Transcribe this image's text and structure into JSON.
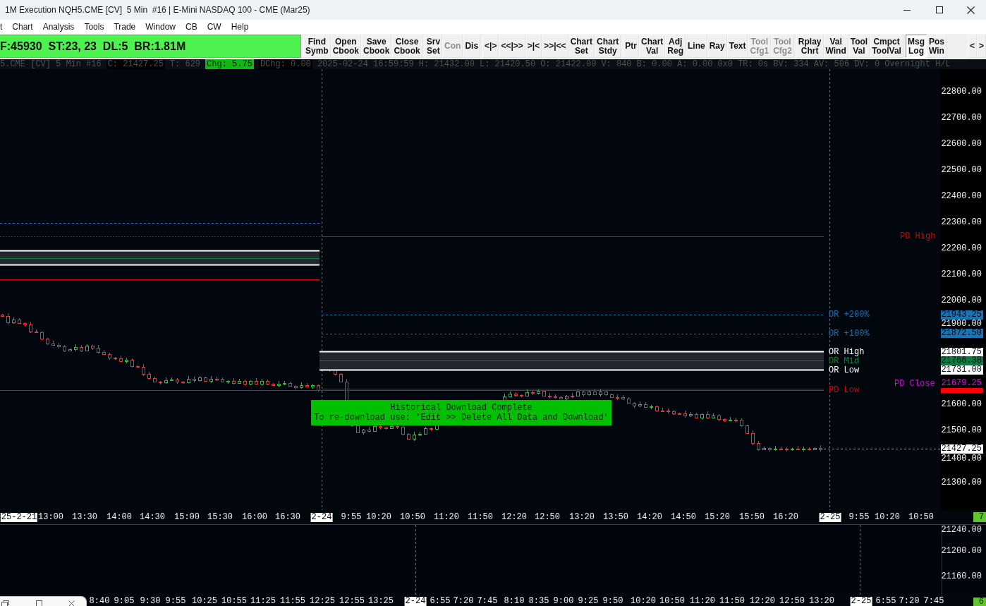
{
  "window": {
    "title": "1M Execution NQH5.CME [CV]  5 Min  #16 | E-Mini NASDAQ 100 - CME (Mar25)"
  },
  "menu": [
    "t",
    "Chart",
    "Analysis",
    "Tools",
    "Trade",
    "Window",
    "CB",
    "CW",
    "Help"
  ],
  "toolbar": {
    "status": "F:45930  ST:23, 23  DL:5  BR:1.81M",
    "groups": [
      [
        {
          "label": "Find\nSymb",
          "disabled": false,
          "on": false
        },
        {
          "label": "Open\nCbook",
          "disabled": false,
          "on": false
        },
        {
          "label": "Save\nCbook",
          "disabled": false,
          "on": false
        },
        {
          "label": "Close\nCbook",
          "disabled": false,
          "on": false
        }
      ],
      [
        {
          "label": "Srv\nSet",
          "disabled": false,
          "on": false
        },
        {
          "label": "Con",
          "disabled": true,
          "on": false
        },
        {
          "label": "Dis",
          "disabled": false,
          "on": false
        }
      ],
      [
        {
          "label": "<|>",
          "disabled": false,
          "on": false
        },
        {
          "label": "<<|>>",
          "disabled": false,
          "on": false
        },
        {
          "label": ">|<",
          "disabled": false,
          "on": false
        },
        {
          "label": ">>|<<",
          "disabled": false,
          "on": false
        },
        {
          "label": "Chart\nSet",
          "disabled": false,
          "on": false
        },
        {
          "label": "Chart\nStdy",
          "disabled": false,
          "on": false
        }
      ],
      [
        {
          "label": "Ptr",
          "disabled": false,
          "on": false
        },
        {
          "label": "Chart\nVal",
          "disabled": false,
          "on": false
        },
        {
          "label": "Adj\nReg",
          "disabled": false,
          "on": false
        },
        {
          "label": "Line",
          "disabled": false,
          "on": false
        },
        {
          "label": "Ray",
          "disabled": false,
          "on": false
        },
        {
          "label": "Text",
          "disabled": false,
          "on": false
        },
        {
          "label": "Tool\nCfg1",
          "disabled": true,
          "on": false
        },
        {
          "label": "Tool\nCfg2",
          "disabled": true,
          "on": false
        }
      ],
      [
        {
          "label": "Rplay\nChrt",
          "disabled": false,
          "on": false
        },
        {
          "label": "Val\nWind",
          "disabled": false,
          "on": false
        },
        {
          "label": "Tool\nVal",
          "disabled": false,
          "on": false
        },
        {
          "label": "Cmpct\nToolVal",
          "disabled": false,
          "on": false
        }
      ],
      [
        {
          "label": "Msg\nLog",
          "disabled": false,
          "on": true
        },
        {
          "label": "Pos\nWin",
          "disabled": false,
          "on": false
        }
      ],
      [
        {
          "label": "<",
          "disabled": false,
          "on": false
        },
        {
          "label": ">",
          "disabled": false,
          "on": false
        }
      ]
    ]
  },
  "info_bar": [
    {
      "text": "5.CME [CV]",
      "kind": "plain"
    },
    {
      "text": "5 Min",
      "kind": "plain"
    },
    {
      "text": "#16",
      "kind": "plain"
    },
    {
      "text": "C: 21427.25",
      "kind": "boxed"
    },
    {
      "text": "T: 629",
      "kind": "plain"
    },
    {
      "text": "Chg: 5.75",
      "kind": "green"
    },
    {
      "text": "DChg: 0.00",
      "kind": "boxed"
    },
    {
      "text": "2025-02-24 16:59:59",
      "kind": "plain"
    },
    {
      "text": "H: 21432.00",
      "kind": "plain"
    },
    {
      "text": "L: 21420.50",
      "kind": "plain"
    },
    {
      "text": "O: 21422.00",
      "kind": "plain"
    },
    {
      "text": "V: 840",
      "kind": "plain"
    },
    {
      "text": "B: 0.00",
      "kind": "plain"
    },
    {
      "text": "A: 0.00",
      "kind": "plain"
    },
    {
      "text": "0x0",
      "kind": "plain"
    },
    {
      "text": "TR: 0s",
      "kind": "plain"
    },
    {
      "text": "BV: 334",
      "kind": "plain"
    },
    {
      "text": "AV: 506",
      "kind": "plain"
    },
    {
      "text": "DV: 0",
      "kind": "plain"
    },
    {
      "text": "Overnight H/L",
      "kind": "plain"
    }
  ],
  "chart": {
    "price_axis": [
      "22800.00",
      "22700.00",
      "22600.00",
      "22500.00",
      "22400.00",
      "22300.00",
      "22200.00",
      "22100.00",
      "22000.00",
      "21900.00",
      "21600.00",
      "21500.00",
      "21400.00",
      "21300.00"
    ],
    "levels": [
      {
        "label": "PD High",
        "color": "#e00000"
      },
      {
        "label": "OR +200%",
        "color": "#1b72b5"
      },
      {
        "label": "OR +100%",
        "color": "#1b72b5"
      },
      {
        "label": "OR High",
        "color": "#ffffff"
      },
      {
        "label": "OR Mid",
        "color": "#0e8040"
      },
      {
        "label": "OR Low",
        "color": "#ffffff"
      },
      {
        "label": "PD Close",
        "color": "#d800d8"
      },
      {
        "label": "PD Low",
        "color": "#e00000"
      }
    ],
    "price_markers": [
      {
        "text": "21943.25",
        "kind": "fill",
        "color": "#1874b6"
      },
      {
        "text": "21872.50",
        "kind": "fill",
        "color": "#1874b6"
      },
      {
        "text": "21801.75",
        "kind": "fill",
        "color": "#ffffff"
      },
      {
        "text": "21766.38",
        "kind": "fill",
        "color": "#0b7c3c"
      },
      {
        "text": "21731.00",
        "kind": "fill",
        "color": "#ffffff"
      },
      {
        "text": "21679.25",
        "kind": "text",
        "color": "#e000e0"
      },
      {
        "kind": "fill",
        "color": "#ff0000"
      },
      {
        "text": "21427.25",
        "kind": "fill",
        "color": "#ffffff"
      }
    ],
    "notice": {
      "title": "Historical Download Complete",
      "text": "To re-download use: 'Edit >> Delete All Data and Download'"
    },
    "time_axis": {
      "labels": [
        {
          "text": "25-2-21",
          "kind": "date"
        },
        {
          "text": "13:00",
          "kind": "time"
        },
        {
          "text": "13:30",
          "kind": "time"
        },
        {
          "text": "14:00",
          "kind": "time"
        },
        {
          "text": "14:30",
          "kind": "time"
        },
        {
          "text": "15:00",
          "kind": "time"
        },
        {
          "text": "15:30",
          "kind": "time"
        },
        {
          "text": "16:00",
          "kind": "time"
        },
        {
          "text": "16:30",
          "kind": "time"
        },
        {
          "text": "2-24",
          "kind": "date"
        },
        {
          "text": "9:55",
          "kind": "time"
        },
        {
          "text": "10:20",
          "kind": "time"
        },
        {
          "text": "10:50",
          "kind": "time"
        },
        {
          "text": "11:20",
          "kind": "time"
        },
        {
          "text": "11:50",
          "kind": "time"
        },
        {
          "text": "12:20",
          "kind": "time"
        },
        {
          "text": "12:50",
          "kind": "time"
        },
        {
          "text": "13:20",
          "kind": "time"
        },
        {
          "text": "13:50",
          "kind": "time"
        },
        {
          "text": "14:20",
          "kind": "time"
        },
        {
          "text": "14:50",
          "kind": "time"
        },
        {
          "text": "15:20",
          "kind": "time"
        },
        {
          "text": "15:50",
          "kind": "time"
        },
        {
          "text": "16:20",
          "kind": "time"
        },
        {
          "text": "2-25",
          "kind": "date"
        },
        {
          "text": "9:55",
          "kind": "time"
        },
        {
          "text": "10:20",
          "kind": "time"
        },
        {
          "text": "10:50",
          "kind": "time"
        }
      ],
      "badge": "7"
    }
  },
  "lower_pane": {
    "price_axis": [
      "21240.00",
      "21200.00",
      "21160.00"
    ],
    "time_axis": {
      "labels": [
        {
          "text": "8:40",
          "kind": "time"
        },
        {
          "text": "9:05",
          "kind": "time"
        },
        {
          "text": "9:30",
          "kind": "time"
        },
        {
          "text": "9:55",
          "kind": "time"
        },
        {
          "text": "10:25",
          "kind": "time"
        },
        {
          "text": "10:55",
          "kind": "time"
        },
        {
          "text": "11:25",
          "kind": "time"
        },
        {
          "text": "11:55",
          "kind": "time"
        },
        {
          "text": "12:25",
          "kind": "time"
        },
        {
          "text": "12:55",
          "kind": "time"
        },
        {
          "text": "13:25",
          "kind": "time"
        },
        {
          "text": "2-24",
          "kind": "date"
        },
        {
          "text": "6:55",
          "kind": "time"
        },
        {
          "text": "7:20",
          "kind": "time"
        },
        {
          "text": "7:45",
          "kind": "time"
        },
        {
          "text": "8:10",
          "kind": "time"
        },
        {
          "text": "8:35",
          "kind": "time"
        },
        {
          "text": "9:00",
          "kind": "time"
        },
        {
          "text": "9:25",
          "kind": "time"
        },
        {
          "text": "9:50",
          "kind": "time"
        },
        {
          "text": "10:20",
          "kind": "time"
        },
        {
          "text": "10:50",
          "kind": "time"
        },
        {
          "text": "11:20",
          "kind": "time"
        },
        {
          "text": "11:50",
          "kind": "time"
        },
        {
          "text": "12:20",
          "kind": "time"
        },
        {
          "text": "12:50",
          "kind": "time"
        },
        {
          "text": "13:20",
          "kind": "time"
        },
        {
          "text": "2-25",
          "kind": "date"
        },
        {
          "text": "6:55",
          "kind": "time"
        },
        {
          "text": "7:20",
          "kind": "time"
        },
        {
          "text": "7:45",
          "kind": "time"
        }
      ],
      "badge": "6"
    }
  }
}
